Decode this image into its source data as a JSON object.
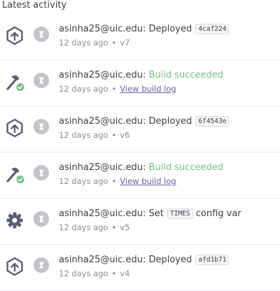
{
  "header": {
    "title": "Latest activity"
  },
  "activity": [
    {
      "kind": "deploy",
      "icon": "deploy-icon",
      "user": "asinha25@uic.edu",
      "action": "Deployed",
      "code": "4caf224",
      "suffix": "",
      "time": "12 days ago",
      "meta": "v7"
    },
    {
      "kind": "build",
      "icon": "build-icon",
      "user": "asinha25@uic.edu",
      "action": "Build succeeded",
      "code": "",
      "suffix": "",
      "time": "12 days ago",
      "meta": "View build log"
    },
    {
      "kind": "deploy",
      "icon": "deploy-icon",
      "user": "asinha25@uic.edu",
      "action": "Deployed",
      "code": "6f4543e",
      "suffix": "",
      "time": "12 days ago",
      "meta": "v6"
    },
    {
      "kind": "build",
      "icon": "build-icon",
      "user": "asinha25@uic.edu",
      "action": "Build succeeded",
      "code": "",
      "suffix": "",
      "time": "12 days ago",
      "meta": "View build log"
    },
    {
      "kind": "config",
      "icon": "gear-icon",
      "user": "asinha25@uic.edu",
      "action": "Set",
      "code": "TIMES",
      "suffix": "config var",
      "time": "12 days ago",
      "meta": "v5"
    },
    {
      "kind": "deploy",
      "icon": "deploy-icon",
      "user": "asinha25@uic.edu",
      "action": "Deployed",
      "code": "afd1b71",
      "suffix": "",
      "time": "12 days ago",
      "meta": "v4"
    }
  ],
  "colors": {
    "success": "#74c080",
    "link": "#6a5aa8",
    "icon": "#5b5f75",
    "muted": "#8d8d98"
  }
}
